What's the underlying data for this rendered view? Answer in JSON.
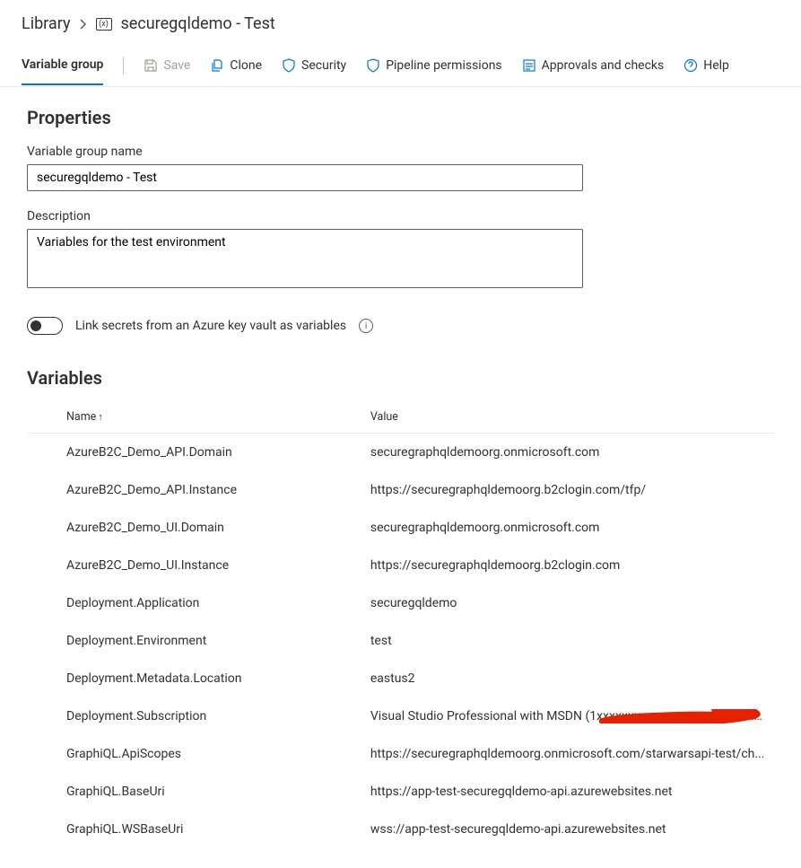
{
  "breadcrumb": {
    "root": "Library",
    "current": "securegqldemo - Test"
  },
  "tabs": {
    "variable_group": "Variable group"
  },
  "commands": {
    "save": "Save",
    "clone": "Clone",
    "security": "Security",
    "pipeline_permissions": "Pipeline permissions",
    "approvals_and_checks": "Approvals and checks",
    "help": "Help"
  },
  "sections": {
    "properties_title": "Properties",
    "name_label": "Variable group name",
    "name_value": "securegqldemo - Test",
    "description_label": "Description",
    "description_value": "Variables for the test environment",
    "link_kv_label": "Link secrets from an Azure key vault as variables",
    "variables_title": "Variables"
  },
  "table": {
    "col_name": "Name",
    "col_value": "Value",
    "rows": [
      {
        "name": "AzureB2C_Demo_API.Domain",
        "value": "securegraphqldemoorg.onmicrosoft.com"
      },
      {
        "name": "AzureB2C_Demo_API.Instance",
        "value": "https://securegraphqldemoorg.b2clogin.com/tfp/"
      },
      {
        "name": "AzureB2C_Demo_UI.Domain",
        "value": "securegraphqldemoorg.onmicrosoft.com"
      },
      {
        "name": "AzureB2C_Demo_UI.Instance",
        "value": "https://securegraphqldemoorg.b2clogin.com"
      },
      {
        "name": "Deployment.Application",
        "value": "securegqldemo"
      },
      {
        "name": "Deployment.Environment",
        "value": "test"
      },
      {
        "name": "Deployment.Metadata.Location",
        "value": "eastus2"
      },
      {
        "name": "Deployment.Subscription",
        "value": "Visual Studio Professional with MSDN (1xxxxxxx-xxxx-xxxx-xxxx-xxxxxxxxxxxx..."
      },
      {
        "name": "GraphiQL.ApiScopes",
        "value": "https://securegraphqldemoorg.onmicrosoft.com/starwarsapi-test/ch..."
      },
      {
        "name": "GraphiQL.BaseUri",
        "value": "https://app-test-securegqldemo-api.azurewebsites.net"
      },
      {
        "name": "GraphiQL.WSBaseUri",
        "value": "wss://app-test-securegqldemo-api.azurewebsites.net"
      }
    ]
  }
}
